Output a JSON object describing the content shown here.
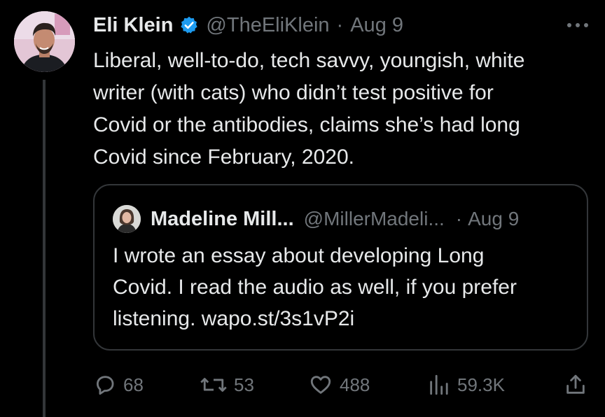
{
  "tweet": {
    "author_name": "Eli Klein",
    "handle": "@TheEliKlein",
    "separator": "·",
    "date": "Aug 9",
    "text": "Liberal, well-to-do, tech savvy, youngish, white\nwriter (with cats) who didn’t test positive for\nCovid or the antibodies, claims she’s had long\nCovid since February, 2020.",
    "verified": true
  },
  "quoted_tweet": {
    "author_name": "Madeline Mill...",
    "handle": "@MillerMadeli...",
    "separator": "·",
    "date": "Aug 9",
    "text": "I wrote an essay about developing Long\nCovid. I read the audio as well, if you prefer\nlistening. wapo.st/3s1vP2i"
  },
  "actions": {
    "replies": "68",
    "reposts": "53",
    "likes": "488",
    "views": "59.3K"
  },
  "icons": {
    "verified": "verified-badge-icon",
    "more": "more-options-icon",
    "reply": "reply-icon",
    "repost": "repost-icon",
    "like": "heart-icon",
    "views": "views-chart-icon",
    "share": "share-icon"
  },
  "colors": {
    "background": "#000000",
    "text": "#e7e9ea",
    "secondary_text": "#71767b",
    "verified_blue": "#1d9bf0",
    "border": "#333639"
  }
}
